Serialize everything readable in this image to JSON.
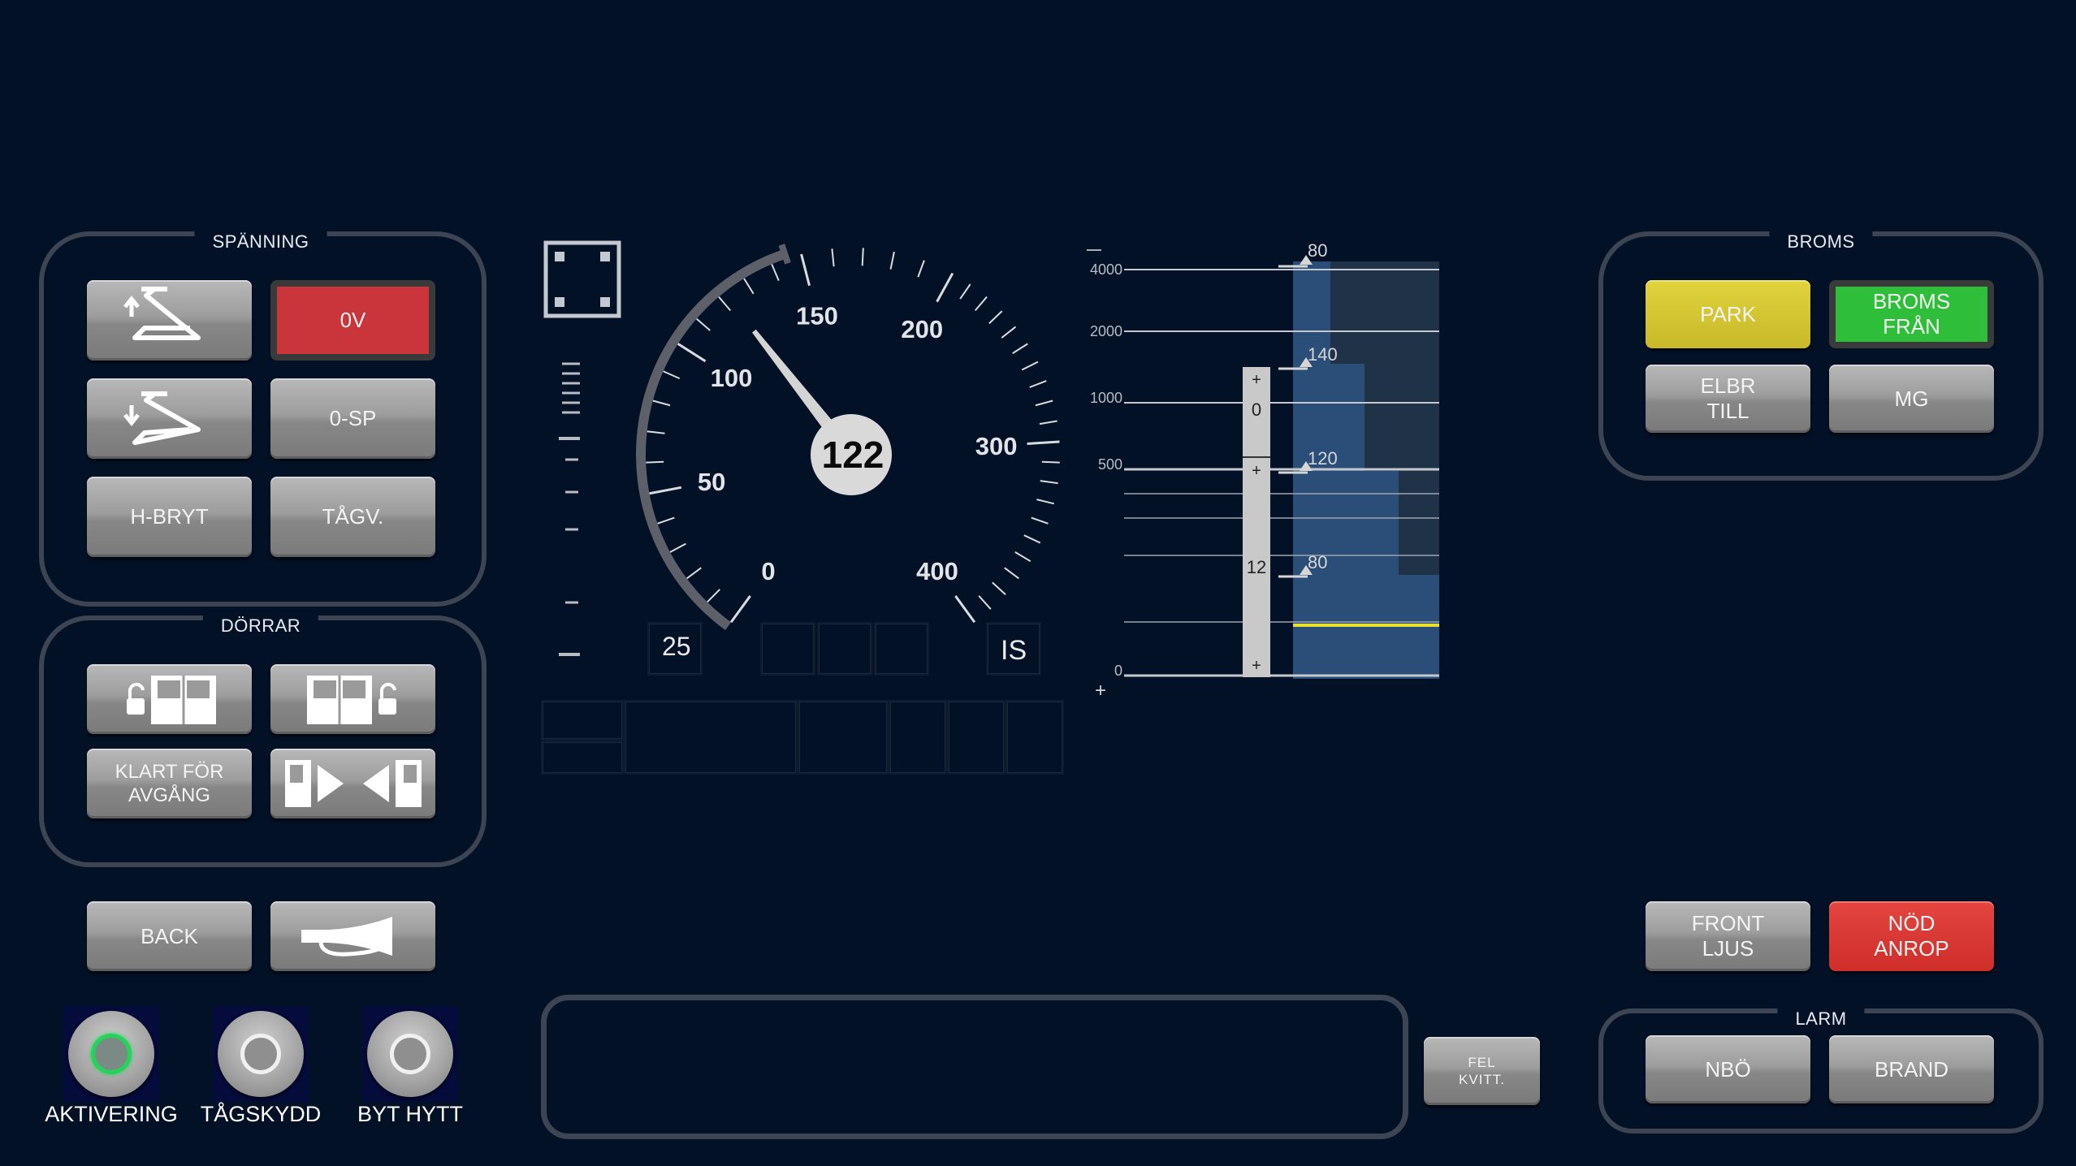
{
  "spanning": {
    "title": "SPÄNNING",
    "zero_v": "0V",
    "zero_sp": "0-SP",
    "h_bryt": "H-BRYT",
    "tagv": "TÅGV."
  },
  "dorrar": {
    "title": "DÖRRAR",
    "klart_for_avgang": "KLART FÖR\nAVGÅNG"
  },
  "left_bottom": {
    "back": "BACK",
    "aktivering": "AKTIVERING",
    "tagskydd": "TÅGSKYDD",
    "byt_hytt": "BYT HYTT"
  },
  "speedometer": {
    "current_speed": "122",
    "scale_labels": [
      "0",
      "50",
      "100",
      "150",
      "200",
      "300",
      "400"
    ],
    "target_distance": "25",
    "mode": "IS"
  },
  "planning": {
    "distance_labels": [
      "4000",
      "2000",
      "1000",
      "500",
      "0"
    ],
    "speed_markers": [
      "80",
      "140",
      "120",
      "80"
    ],
    "gradient_top": "0",
    "gradient_bottom": "12",
    "plus": "+"
  },
  "broms": {
    "title": "BROMS",
    "park": "PARK",
    "broms_fran": "BROMS\nFRÅN",
    "elbr_till": "ELBR\nTILL",
    "mg": "MG"
  },
  "right_bottom": {
    "front_ljus": "FRONT\nLJUS",
    "nod_anrop": "NÖD\nANROP",
    "fel_kvitt": "FEL\nKVITT."
  },
  "larm": {
    "title": "LARM",
    "nbo": "NBÖ",
    "brand": "BRAND"
  },
  "colors": {
    "background": "#031127",
    "park": "#d6c935",
    "broms_fran": "#2fbe3a",
    "zero_v": "#c9353a",
    "nod_anrop": "#d9342f"
  }
}
